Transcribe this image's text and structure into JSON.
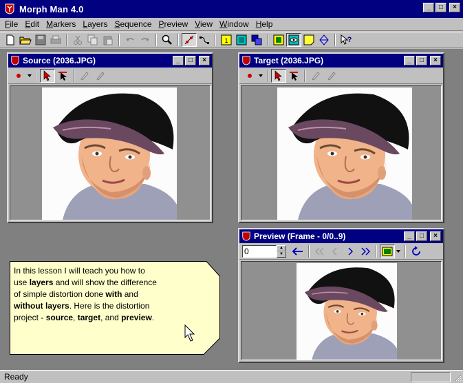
{
  "app": {
    "title": "Morph Man 4.0",
    "window_buttons": [
      "_",
      "□",
      "×"
    ]
  },
  "menu": [
    {
      "label": "File",
      "accel": "F",
      "rest": "ile"
    },
    {
      "label": "Edit",
      "accel": "E",
      "rest": "dit"
    },
    {
      "label": "Markers",
      "accel": "M",
      "rest": "arkers"
    },
    {
      "label": "Layers",
      "accel": "L",
      "rest": "ayers"
    },
    {
      "label": "Sequence",
      "accel": "S",
      "rest": "equence"
    },
    {
      "label": "Preview",
      "accel": "P",
      "rest": "review"
    },
    {
      "label": "View",
      "accel": "V",
      "rest": "iew"
    },
    {
      "label": "Window",
      "accel": "W",
      "rest": "indow"
    },
    {
      "label": "Help",
      "accel": "H",
      "rest": "elp"
    }
  ],
  "toolbar": {
    "icons": [
      "new-file-icon",
      "open-folder-icon",
      "save-icon",
      "print-icon",
      "cut-icon",
      "copy-icon",
      "paste-icon",
      "undo-icon",
      "redo-icon",
      "zoom-icon",
      "edit-markers-icon",
      "edit-curves-icon",
      "layer-yellow-icon",
      "layer-cyan-icon",
      "layer-stack-icon",
      "view-source-icon",
      "view-eye-icon",
      "note-icon",
      "diamond-icon",
      "context-help-icon"
    ]
  },
  "source_window": {
    "title": "Source (2036.JPG)"
  },
  "target_window": {
    "title": "Target (2036.JPG)"
  },
  "preview_window": {
    "title": "Preview (Frame - 0/0..9)",
    "frame_value": "0"
  },
  "note": {
    "lines": [
      [
        {
          "t": "In this lesson I will teach you how to",
          "b": false
        }
      ],
      [
        {
          "t": "use ",
          "b": false
        },
        {
          "t": "layers",
          "b": true
        },
        {
          "t": " and will show the difference",
          "b": false
        }
      ],
      [
        {
          "t": "of simple distortion done ",
          "b": false
        },
        {
          "t": "with",
          "b": true
        },
        {
          "t": " and",
          "b": false
        }
      ],
      [
        {
          "t": "without layers",
          "b": true
        },
        {
          "t": ". Here is the distortion",
          "b": false
        }
      ],
      [
        {
          "t": "project - ",
          "b": false
        },
        {
          "t": "source",
          "b": true
        },
        {
          "t": ", ",
          "b": false
        },
        {
          "t": "target",
          "b": true
        },
        {
          "t": ", and ",
          "b": false
        },
        {
          "t": "preview",
          "b": true
        },
        {
          "t": ".",
          "b": false
        }
      ]
    ]
  },
  "status": {
    "text": "Ready"
  },
  "colors": {
    "titlebar": "#000080",
    "face": "#c0c0c0",
    "workspace": "#808080",
    "note_bg": "#ffffcc"
  }
}
